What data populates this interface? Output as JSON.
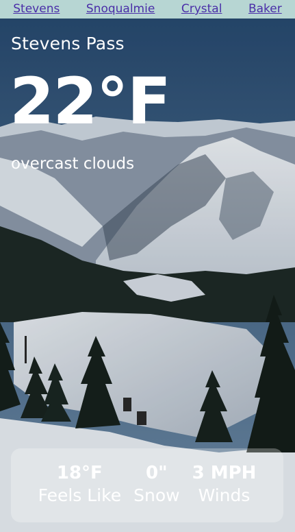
{
  "nav": {
    "links": [
      "Stevens",
      "Snoqualmie",
      "Crystal",
      "Baker"
    ]
  },
  "weather": {
    "location": "Stevens Pass",
    "temperature": "22°F",
    "condition": "overcast clouds"
  },
  "stats": {
    "feels_like_value": "18°F",
    "feels_like_label": "Feels Like",
    "snow_value": "0\"",
    "snow_label": "Snow",
    "wind_value": "3 MPH",
    "wind_label": "Winds"
  },
  "colors": {
    "nav_background": "#b7d6d3",
    "nav_link": "#4a2ea8",
    "text": "#ffffff"
  },
  "background_icon": "snowy-mountain-photo"
}
